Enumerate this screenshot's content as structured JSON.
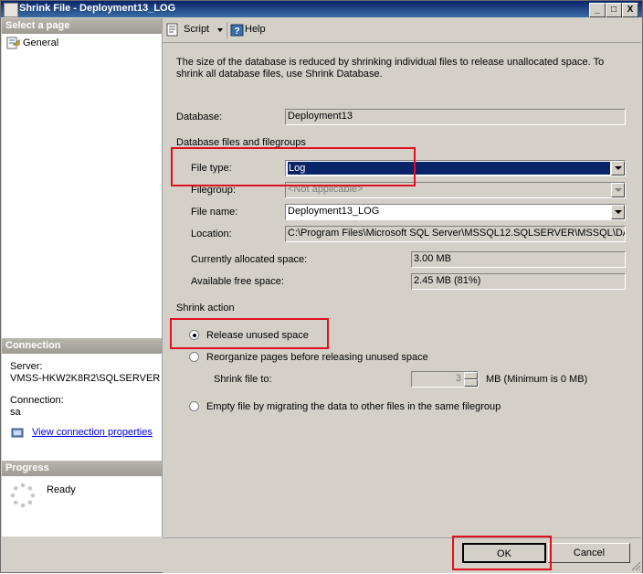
{
  "window": {
    "title": "Shrink File - Deployment13_LOG",
    "minimize_label": "_",
    "maximize_label": "□",
    "close_label": "X"
  },
  "left": {
    "select_page_header": "Select a page",
    "pages": [
      "General"
    ],
    "connection_header": "Connection",
    "server_label": "Server:",
    "server_value": "VMSS-HKW2K8R2\\SQLSERVER",
    "connection_label": "Connection:",
    "connection_value": "sa",
    "view_connection_link": "View connection properties",
    "progress_header": "Progress",
    "progress_status": "Ready"
  },
  "toolbar": {
    "script_label": "Script",
    "help_label": "Help"
  },
  "main": {
    "description": "The size of the database is reduced by shrinking individual files to release unallocated space. To shrink all database files, use Shrink Database.",
    "database_label": "Database:",
    "database_value": "Deployment13",
    "files_group_label": "Database files and filegroups",
    "file_type_label": "File type:",
    "file_type_value": "Log",
    "filegroup_label": "Filegroup:",
    "filegroup_value": "<Not applicable>",
    "file_name_label": "File name:",
    "file_name_value": "Deployment13_LOG",
    "location_label": "Location:",
    "location_value": "C:\\Program Files\\Microsoft SQL Server\\MSSQL12.SQLSERVER\\MSSQL\\DA",
    "allocated_label": "Currently allocated space:",
    "allocated_value": "3.00 MB",
    "free_label": "Available free space:",
    "free_value": "2.45 MB (81%)",
    "shrink_action_label": "Shrink action",
    "release_unused_label": "Release unused space",
    "reorganize_label": "Reorganize pages before releasing unused space",
    "shrink_to_label": "Shrink file to:",
    "shrink_to_value": "3",
    "shrink_to_unit": "MB (Minimum is 0 MB)",
    "empty_file_label": "Empty file by migrating the data to other files in the same filegroup"
  },
  "footer": {
    "ok_label": "OK",
    "cancel_label": "Cancel"
  },
  "colors": {
    "highlight_red": "#e0101e",
    "selection_blue": "#0a246a",
    "title_blue": "#0a246a"
  }
}
